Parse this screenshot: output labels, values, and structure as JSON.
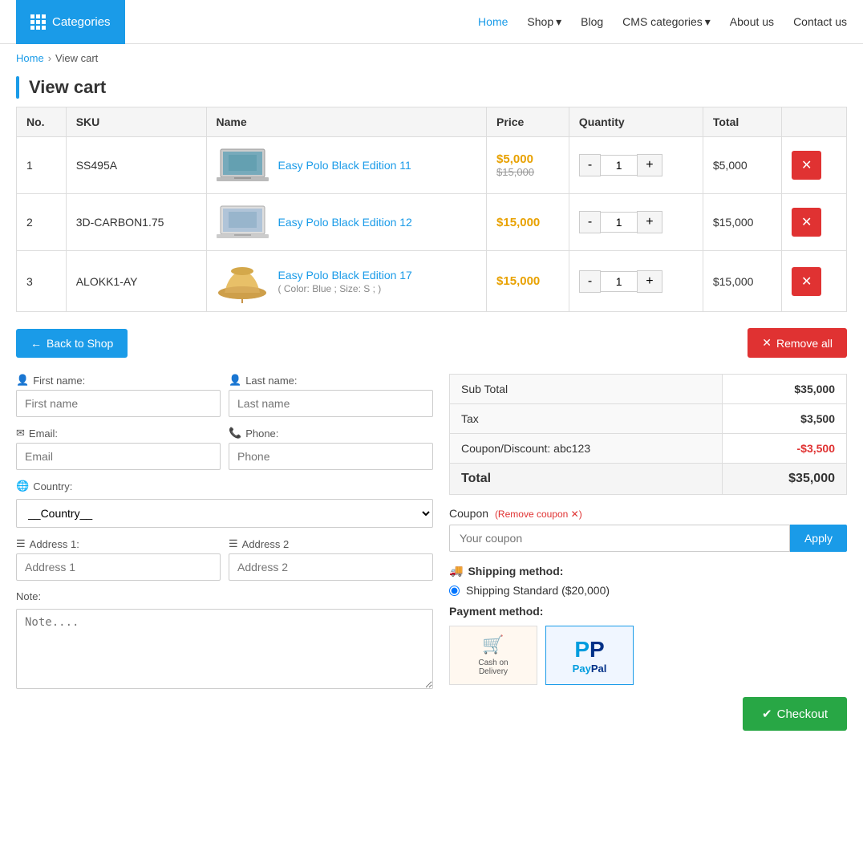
{
  "header": {
    "categories_label": "Categories",
    "nav": [
      {
        "label": "Home",
        "active": true
      },
      {
        "label": "Shop",
        "dropdown": true
      },
      {
        "label": "Blog"
      },
      {
        "label": "CMS categories",
        "dropdown": true
      },
      {
        "label": "About us"
      },
      {
        "label": "Contact us"
      }
    ]
  },
  "breadcrumb": {
    "home": "Home",
    "current": "View cart"
  },
  "page_title": "View cart",
  "table": {
    "headers": [
      "No.",
      "SKU",
      "Name",
      "Price",
      "Quantity",
      "Total",
      ""
    ],
    "rows": [
      {
        "no": 1,
        "sku": "SS495A",
        "name": "Easy Polo Black Edition 11",
        "price_main": "$5,000",
        "price_old": "$15,000",
        "qty": 1,
        "total": "$5,000",
        "type": "laptop1"
      },
      {
        "no": 2,
        "sku": "3D-CARBON1.75",
        "name": "Easy Polo Black Edition 12",
        "price_main": "$15,000",
        "price_old": null,
        "qty": 1,
        "total": "$15,000",
        "type": "laptop2"
      },
      {
        "no": 3,
        "sku": "ALOKK1-AY",
        "name": "Easy Polo Black Edition 17",
        "name_sub": "( Color: Blue ; Size: S ; )",
        "price_main": "$15,000",
        "price_old": null,
        "qty": 1,
        "total": "$15,000",
        "type": "hat"
      }
    ]
  },
  "actions": {
    "back_to_shop": "Back to Shop",
    "remove_all": "Remove all"
  },
  "form": {
    "first_name_label": "First name:",
    "last_name_label": "Last name:",
    "first_name_placeholder": "First name",
    "last_name_placeholder": "Last name",
    "email_label": "Email:",
    "email_placeholder": "Email",
    "phone_label": "Phone:",
    "phone_placeholder": "Phone",
    "country_label": "Country:",
    "country_placeholder": "__Country__",
    "address1_label": "Address 1:",
    "address1_placeholder": "Address 1",
    "address2_label": "Address 2",
    "address2_placeholder": "Address 2",
    "note_label": "Note:",
    "note_placeholder": "Note...."
  },
  "summary": {
    "subtotal_label": "Sub Total",
    "subtotal_value": "$35,000",
    "tax_label": "Tax",
    "tax_value": "$3,500",
    "coupon_label": "Coupon/Discount: abc123",
    "coupon_value": "-$3,500",
    "total_label": "Total",
    "total_value": "$35,000"
  },
  "coupon": {
    "label": "Coupon",
    "remove_label": "(Remove coupon ✕)",
    "placeholder": "Your coupon",
    "apply_label": "Apply"
  },
  "shipping": {
    "title": "Shipping method:",
    "option": "Shipping Standard ($20,000)"
  },
  "payment": {
    "title": "Payment method:",
    "options": [
      "Cash on Delivery",
      "PayPal"
    ]
  },
  "checkout": {
    "label": "Checkout"
  }
}
